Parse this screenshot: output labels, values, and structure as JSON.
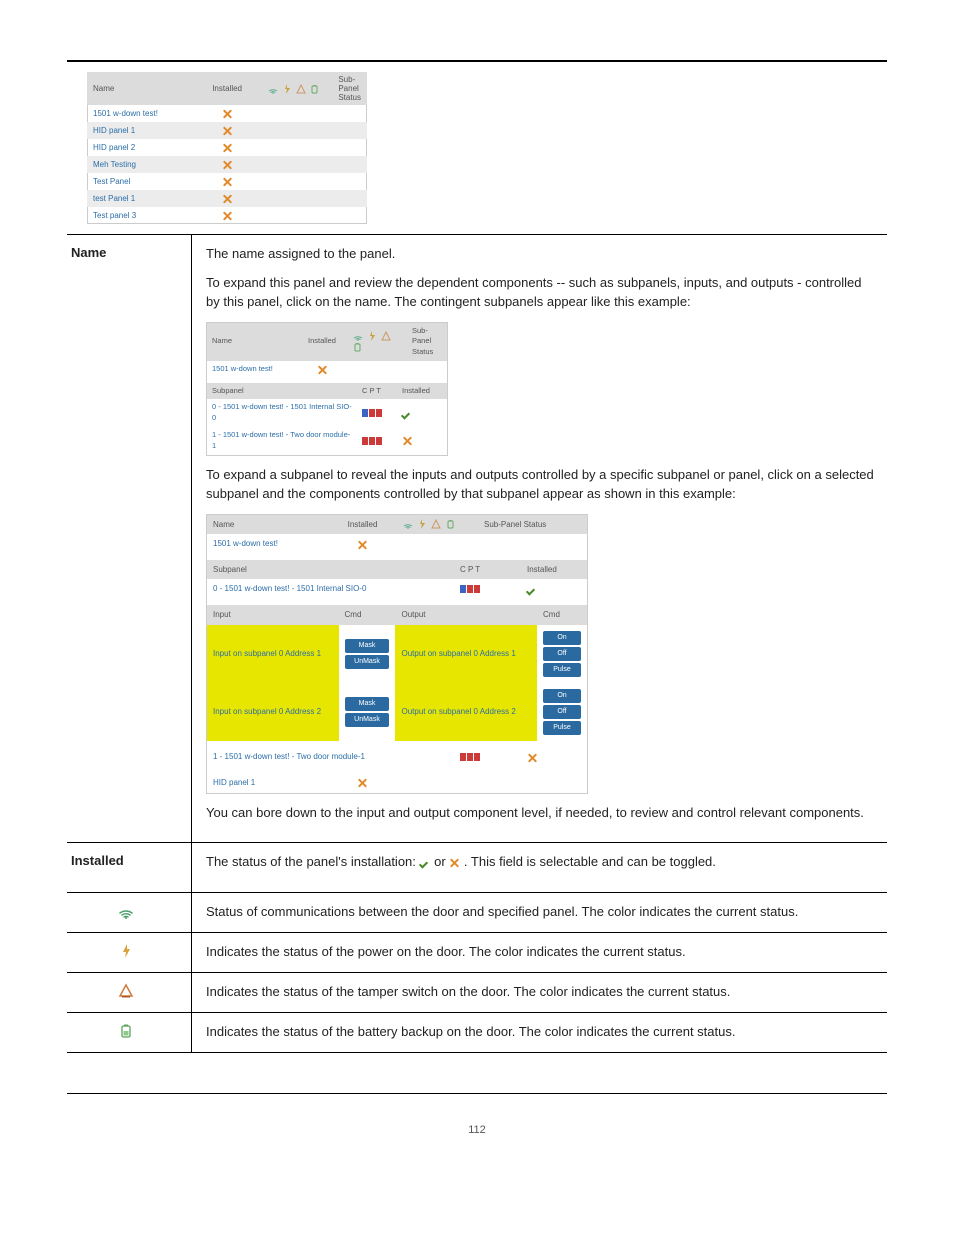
{
  "page_number": "112",
  "top_shot": {
    "headers": [
      "Name",
      "Installed",
      "",
      "",
      "",
      "",
      "Sub-Panel Status"
    ],
    "rows": [
      {
        "name": "1501 w-down test!",
        "installed": "x"
      },
      {
        "name": "HID panel 1",
        "installed": "x"
      },
      {
        "name": "HID panel 2",
        "installed": "x"
      },
      {
        "name": "Meh Testing",
        "installed": "x"
      },
      {
        "name": "Test Panel",
        "installed": "x"
      },
      {
        "name": "test Panel 1",
        "installed": "x"
      },
      {
        "name": "Test panel 3",
        "installed": "x"
      }
    ]
  },
  "def": {
    "name_label": "Name",
    "name_p1": "The name assigned to the panel.",
    "name_p2": "To expand this panel and review the dependent components -- such as subpanels, inputs, and outputs - controlled by this panel, click on the name. The contingent subpanels appear like this example:",
    "name_p3": "To expand a subpanel to reveal the inputs and outputs controlled by a specific subpanel or panel, click on a selected subpanel and the components controlled by that subpanel appear as shown in this example:",
    "name_p4": "You can bore down to the input and output component level, if needed, to review and control relevant components.",
    "installed_label": "Installed",
    "installed_pre": "The status of the panel's installation: ",
    "installed_mid": " or ",
    "installed_post": ". This field is selectable and can be toggled.",
    "comm_text": "Status of communications between the door and specified panel. The color indicates the current status.",
    "power_text": "Indicates the status of the power on the door. The color indicates the current status.",
    "tamper_text": "Indicates the status of the tamper switch on the door. The color indicates the current status.",
    "battery_text": "Indicates the status of the battery backup on the door. The color indicates the current status."
  },
  "shot2": {
    "headers": [
      "Name",
      "Installed",
      "",
      "",
      "",
      "",
      "Sub-Panel Status"
    ],
    "row1": {
      "name": "1501 w-down test!",
      "installed": "x"
    },
    "sub_headers": [
      "Subpanel",
      "C P T",
      "Installed"
    ],
    "subrows": [
      {
        "name": "0 - 1501 w-down test! - 1501 Internal SIO-0",
        "cpt": [
          "#3b64c4",
          "#cc3a3a",
          "#cc3a3a"
        ],
        "installed": "check"
      },
      {
        "name": "1 - 1501 w-down test! - Two door module-1",
        "cpt": [
          "#cc3a3a",
          "#cc3a3a",
          "#cc3a3a"
        ],
        "installed": "x"
      }
    ]
  },
  "shot3": {
    "headers": [
      "Name",
      "Installed",
      "",
      "Sub-Panel Status"
    ],
    "row1": {
      "name": "1501 w-down test!"
    },
    "sub_headers": [
      "Subpanel",
      "C P T",
      "Installed"
    ],
    "subrow": {
      "name": "0 - 1501 w-down test! - 1501 Internal SIO-0",
      "cpt": [
        "#3b64c4",
        "#cc3a3a",
        "#cc3a3a"
      ]
    },
    "io_headers_in": "Input",
    "io_headers_cmd": "Cmd",
    "io_headers_out": "Output",
    "inputs": [
      {
        "name": "Input on subpanel 0 Address 1",
        "cmds": [
          "Mask",
          "UnMask"
        ]
      },
      {
        "name": "Input on subpanel 0 Address 2",
        "cmds": [
          "Mask",
          "UnMask"
        ]
      }
    ],
    "outputs": [
      {
        "name": "Output on subpanel 0 Address 1",
        "cmds": [
          "On",
          "Off",
          "Pulse"
        ]
      },
      {
        "name": "Output on subpanel 0 Address 2",
        "cmds": [
          "On",
          "Off",
          "Pulse"
        ]
      }
    ],
    "tail1": {
      "name": "1 - 1501 w-down test! - Two door module-1",
      "cpt": [
        "#cc3a3a",
        "#cc3a3a",
        "#cc3a3a"
      ]
    },
    "tail2": {
      "name": "HID panel 1"
    }
  }
}
